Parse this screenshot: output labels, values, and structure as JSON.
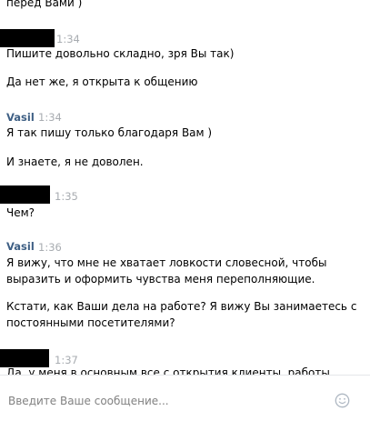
{
  "messages": [
    {
      "text": "перед Вами )"
    },
    {
      "time": "1:34",
      "lines": [
        "Пишите довольно складно, зря Вы так)",
        "Да нет же, я открыта к общению"
      ]
    },
    {
      "author": "Vasil",
      "time": "1:34",
      "lines": [
        "Я так пишу только благодаря Вам )",
        "И знаете, я не доволен."
      ]
    },
    {
      "time": "1:35",
      "lines": [
        "Чем?"
      ]
    },
    {
      "author": "Vasil",
      "time": "1:36",
      "lines": [
        "Я вижу, что мне не хватает ловкости словесной, чтобы",
        "выразить и оформить чувства меня переполняющие.",
        "Кстати, как Ваши дела на работе? Я вижу Вы занимаетесь с",
        "постоянными посетителями?"
      ]
    },
    {
      "time": "1:37",
      "lines": [
        "Да, у меня в основным все с открытия клиенты, работы"
      ]
    }
  ],
  "composer": {
    "placeholder": "Введите Ваше сообщение...",
    "emoji_icon": "smile-icon"
  },
  "colors": {
    "author": "#3e5f84",
    "time": "#a8acb1",
    "placeholder": "#828282",
    "divider": "#e4e6e9"
  }
}
